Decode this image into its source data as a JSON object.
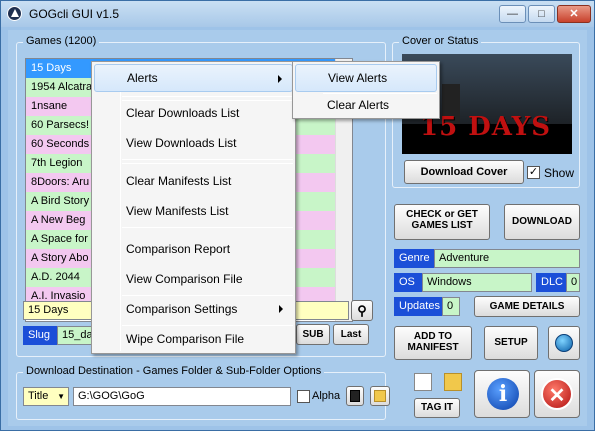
{
  "window": {
    "title": "GOGcli GUI v1.5",
    "min_glyph": "—",
    "max_glyph": "□",
    "close_glyph": "✕"
  },
  "games": {
    "group_title": "Games  (1200)",
    "items": [
      {
        "name": "15 Days",
        "color": "selected"
      },
      {
        "name": "1954 Alcatra",
        "color": "#c8f5c8"
      },
      {
        "name": "1nsane",
        "color": "#f3c8f0"
      },
      {
        "name": "60 Parsecs!",
        "color": "#c8f5c8"
      },
      {
        "name": "60 Seconds",
        "color": "#f3c8f0"
      },
      {
        "name": "7th Legion",
        "color": "#c8f5c8"
      },
      {
        "name": "8Doors: Aru",
        "color": "#f3c8f0"
      },
      {
        "name": "A Bird Story",
        "color": "#c8f5c8"
      },
      {
        "name": "A New Beg",
        "color": "#f3c8f0"
      },
      {
        "name": "A Space for",
        "color": "#c8f5c8"
      },
      {
        "name": "A Story Abo",
        "color": "#f3c8f0"
      },
      {
        "name": "A.D. 2044",
        "color": "#c8f5c8"
      },
      {
        "name": "A.I. Invasio",
        "color": "#f3c8f0"
      }
    ],
    "title_field": "15 Days",
    "slug_label": "Slug",
    "slug_value": "15_da",
    "sub_button": "SUB",
    "last_button": "Last"
  },
  "cover": {
    "group_title": "Cover or Status",
    "image_text": "15 DAYS",
    "download_cover": "Download Cover",
    "show_label": "Show",
    "show_checked": true
  },
  "actions": {
    "check_get_line1": "CHECK or GET",
    "check_get_line2": "GAMES LIST",
    "download": "DOWNLOAD",
    "game_details": "GAME DETAILS",
    "add_manifest_line1": "ADD TO",
    "add_manifest_line2": "MANIFEST",
    "setup": "SETUP",
    "tag_it": "TAG IT"
  },
  "details": {
    "genre_label": "Genre",
    "genre_value": "Adventure",
    "os_label": "OS",
    "os_value": "Windows",
    "dlc_label": "DLC",
    "dlc_value": "0",
    "updates_label": "Updates",
    "updates_value": "0"
  },
  "download_dest": {
    "group_title": "Download Destination - Games Folder & Sub-Folder Options",
    "subfolder_option": "Title",
    "path": "G:\\GOG\\GoG",
    "alpha_label": "Alpha",
    "alpha_checked": false
  },
  "context_menu": {
    "items": [
      {
        "label": "Alerts",
        "submenu": true
      },
      {
        "label": "Clear Downloads List"
      },
      {
        "label": "View Downloads List"
      },
      {
        "label": "Clear Manifests List"
      },
      {
        "label": "View Manifests List"
      },
      {
        "label": "Comparison Report"
      },
      {
        "label": "View Comparison File"
      },
      {
        "label": "Comparison Settings",
        "submenu": true
      },
      {
        "label": "Wipe Comparison File"
      }
    ],
    "submenu": [
      {
        "label": "View Alerts"
      },
      {
        "label": "Clear Alerts"
      }
    ]
  },
  "colors": {
    "accent_blue": "#1b4fd8",
    "list_green": "#c8f5c8",
    "list_pink": "#f3c8f0",
    "field_yellow": "#ffffc0",
    "selected": "#3399ff"
  }
}
